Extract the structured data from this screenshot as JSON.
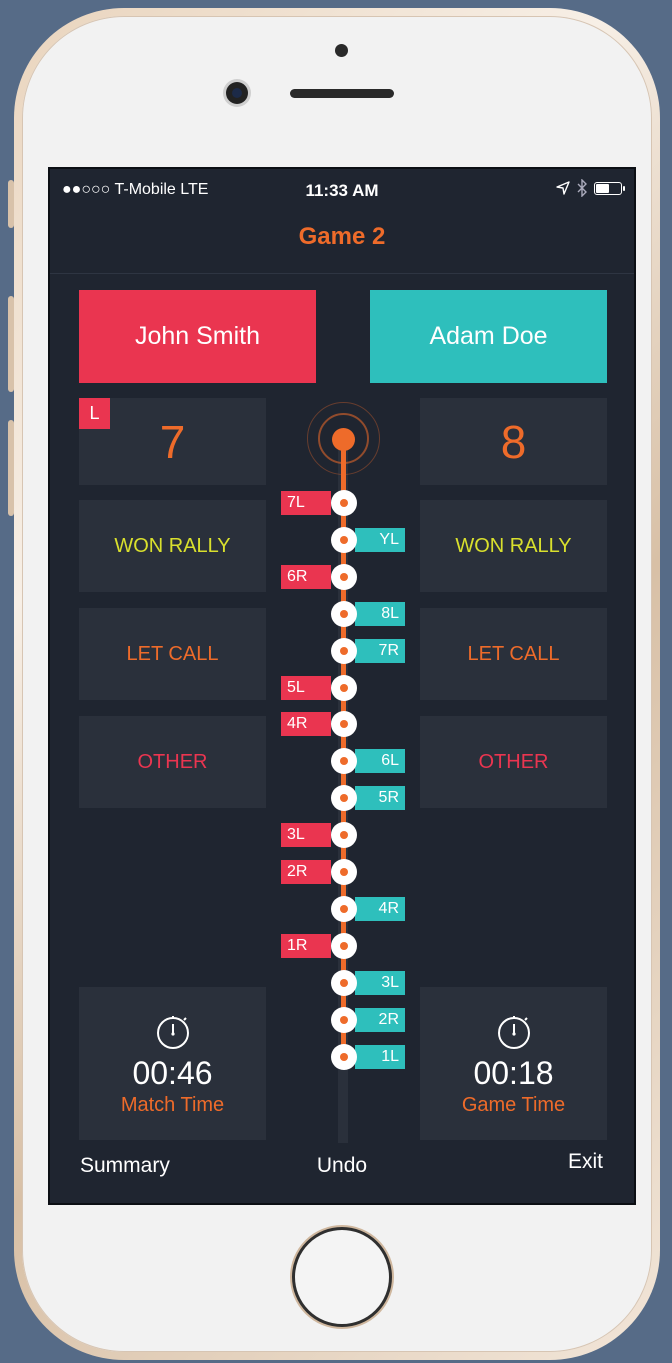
{
  "status_bar": {
    "carrier": "●●○○○ T-Mobile  LTE",
    "time": "11:33 AM",
    "location_icon": "location-arrow-icon",
    "bluetooth_icon": "bluetooth-icon",
    "battery_icon": "battery-icon"
  },
  "nav": {
    "title": "Game 2"
  },
  "players": {
    "left": {
      "name": "John Smith",
      "color": "#ea3550",
      "score": "7",
      "serve_badge": "L"
    },
    "right": {
      "name": "Adam Doe",
      "color": "#2ebfbc",
      "score": "8"
    }
  },
  "actions": {
    "won_rally": "WON RALLY",
    "let_call": "LET CALL",
    "other": "OTHER"
  },
  "timeline": [
    {
      "side": "left",
      "label": "7L"
    },
    {
      "side": "right",
      "label": "YL"
    },
    {
      "side": "left",
      "label": "6R"
    },
    {
      "side": "right",
      "label": "8L"
    },
    {
      "side": "right",
      "label": "7R"
    },
    {
      "side": "left",
      "label": "5L"
    },
    {
      "side": "left",
      "label": "4R"
    },
    {
      "side": "right",
      "label": "6L"
    },
    {
      "side": "right",
      "label": "5R"
    },
    {
      "side": "left",
      "label": "3L"
    },
    {
      "side": "left",
      "label": "2R"
    },
    {
      "side": "right",
      "label": "4R"
    },
    {
      "side": "left",
      "label": "1R"
    },
    {
      "side": "right",
      "label": "3L"
    },
    {
      "side": "right",
      "label": "2R"
    },
    {
      "side": "right",
      "label": "1L"
    }
  ],
  "timers": {
    "match": {
      "value": "00:46",
      "label": "Match Time",
      "icon": "stopwatch-icon"
    },
    "game": {
      "value": "00:18",
      "label": "Game Time",
      "icon": "stopwatch-icon"
    }
  },
  "bottom": {
    "summary": "Summary",
    "undo": "Undo",
    "exit": "Exit"
  },
  "colors": {
    "accent": "#ee6b2a",
    "player1": "#ea3550",
    "player2": "#2ebfbc",
    "won": "#d9e02d",
    "background": "#1f2530",
    "tile": "#2a303b"
  }
}
